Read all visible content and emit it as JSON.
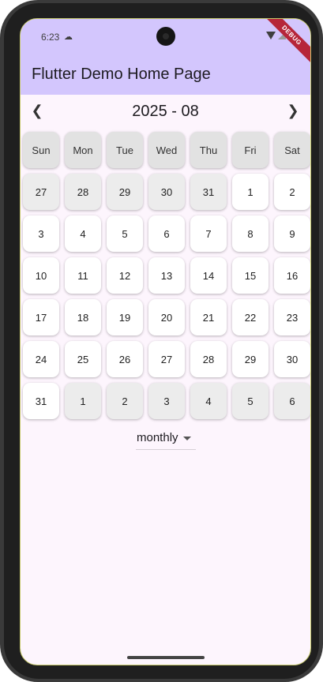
{
  "status": {
    "time": "6:23",
    "weather_icon": "cloud-icon"
  },
  "debug_banner": "DEBUG",
  "appbar": {
    "title": "Flutter Demo Home Page"
  },
  "calendar": {
    "month_label": "2025 - 08",
    "prev_icon": "chevron-left-icon",
    "next_icon": "chevron-right-icon",
    "weekdays": [
      "Sun",
      "Mon",
      "Tue",
      "Wed",
      "Thu",
      "Fri",
      "Sat"
    ],
    "weeks": [
      [
        {
          "d": "27",
          "o": true
        },
        {
          "d": "28",
          "o": true
        },
        {
          "d": "29",
          "o": true
        },
        {
          "d": "30",
          "o": true
        },
        {
          "d": "31",
          "o": true
        },
        {
          "d": "1",
          "o": false
        },
        {
          "d": "2",
          "o": false
        }
      ],
      [
        {
          "d": "3",
          "o": false
        },
        {
          "d": "4",
          "o": false
        },
        {
          "d": "5",
          "o": false
        },
        {
          "d": "6",
          "o": false
        },
        {
          "d": "7",
          "o": false
        },
        {
          "d": "8",
          "o": false
        },
        {
          "d": "9",
          "o": false
        }
      ],
      [
        {
          "d": "10",
          "o": false
        },
        {
          "d": "11",
          "o": false
        },
        {
          "d": "12",
          "o": false
        },
        {
          "d": "13",
          "o": false
        },
        {
          "d": "14",
          "o": false
        },
        {
          "d": "15",
          "o": false
        },
        {
          "d": "16",
          "o": false
        }
      ],
      [
        {
          "d": "17",
          "o": false
        },
        {
          "d": "18",
          "o": false
        },
        {
          "d": "19",
          "o": false
        },
        {
          "d": "20",
          "o": false
        },
        {
          "d": "21",
          "o": false
        },
        {
          "d": "22",
          "o": false
        },
        {
          "d": "23",
          "o": false
        }
      ],
      [
        {
          "d": "24",
          "o": false
        },
        {
          "d": "25",
          "o": false
        },
        {
          "d": "26",
          "o": false
        },
        {
          "d": "27",
          "o": false
        },
        {
          "d": "28",
          "o": false
        },
        {
          "d": "29",
          "o": false
        },
        {
          "d": "30",
          "o": false
        }
      ],
      [
        {
          "d": "31",
          "o": false
        },
        {
          "d": "1",
          "o": true
        },
        {
          "d": "2",
          "o": true
        },
        {
          "d": "3",
          "o": true
        },
        {
          "d": "4",
          "o": true
        },
        {
          "d": "5",
          "o": true
        },
        {
          "d": "6",
          "o": true
        }
      ]
    ]
  },
  "view_selector": {
    "value": "monthly"
  },
  "colors": {
    "appbar": "#d3c6fd",
    "background": "#fdf5fd",
    "other_month_cell": "#ececec",
    "header_cell": "#e2e2e2"
  }
}
